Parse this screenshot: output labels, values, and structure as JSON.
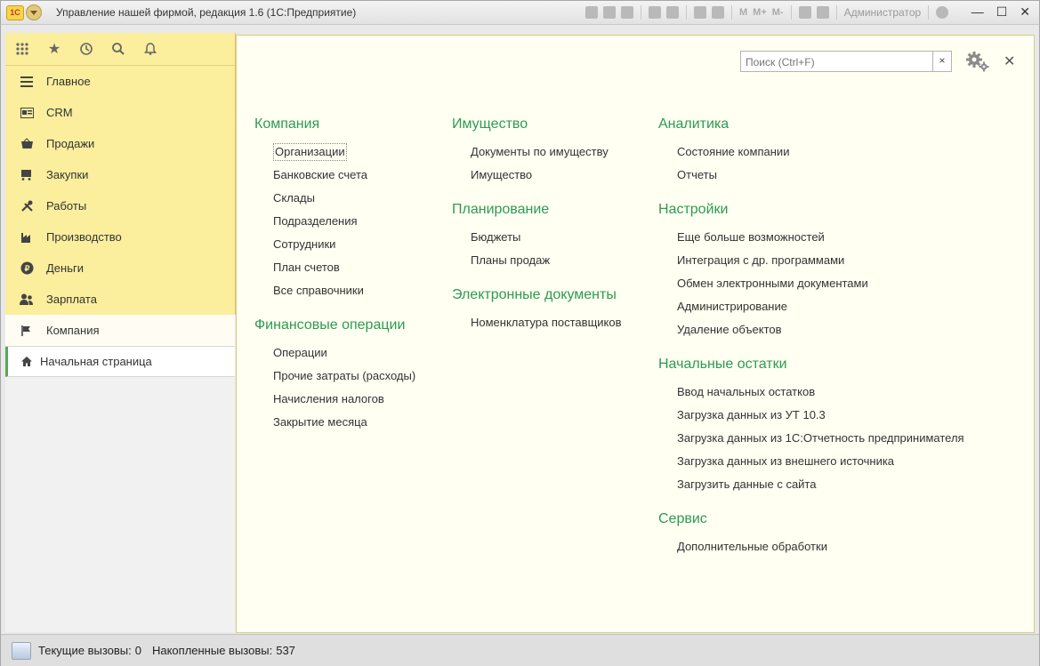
{
  "window": {
    "logo": "1С",
    "title": "Управление нашей фирмой, редакция 1.6  (1С:Предприятие)",
    "toolbar_letters": [
      "M",
      "M+",
      "M-"
    ],
    "user": "Администратор"
  },
  "sidebar": {
    "items": [
      {
        "label": "Главное",
        "icon": "menu-lines"
      },
      {
        "label": "CRM",
        "icon": "card"
      },
      {
        "label": "Продажи",
        "icon": "basket"
      },
      {
        "label": "Закупки",
        "icon": "cart"
      },
      {
        "label": "Работы",
        "icon": "tools"
      },
      {
        "label": "Производство",
        "icon": "factory"
      },
      {
        "label": "Деньги",
        "icon": "ruble-coin"
      },
      {
        "label": "Зарплата",
        "icon": "people"
      }
    ],
    "active_item": {
      "label": "Компания",
      "icon": "flag"
    },
    "home": {
      "label": "Начальная страница",
      "icon": "home"
    }
  },
  "search": {
    "placeholder": "Поиск (Ctrl+F)",
    "clear": "×"
  },
  "columns": [
    [
      {
        "title": "Компания",
        "links": [
          "Организации",
          "Банковские счета",
          "Склады",
          "Подразделения",
          "Сотрудники",
          "План счетов",
          "Все справочники"
        ]
      },
      {
        "title": "Финансовые операции",
        "links": [
          "Операции",
          "Прочие затраты (расходы)",
          "Начисления налогов",
          "Закрытие месяца"
        ]
      }
    ],
    [
      {
        "title": "Имущество",
        "links": [
          "Документы по имуществу",
          "Имущество"
        ]
      },
      {
        "title": "Планирование",
        "links": [
          "Бюджеты",
          "Планы продаж"
        ]
      },
      {
        "title": "Электронные документы",
        "links": [
          "Номенклатура поставщиков"
        ]
      }
    ],
    [
      {
        "title": "Аналитика",
        "links": [
          "Состояние компании",
          "Отчеты"
        ]
      },
      {
        "title": "Настройки",
        "links": [
          "Еще больше возможностей",
          "Интеграция с др. программами",
          "Обмен электронными документами",
          "Администрирование",
          "Удаление объектов"
        ]
      },
      {
        "title": "Начальные остатки",
        "links": [
          "Ввод начальных остатков",
          "Загрузка данных из УТ 10.3",
          "Загрузка данных из 1С:Отчетность предпринимателя",
          "Загрузка данных из внешнего источника",
          "Загрузить данные с сайта"
        ]
      },
      {
        "title": "Сервис",
        "links": [
          "Дополнительные обработки"
        ]
      }
    ]
  ],
  "status": {
    "current_label": "Текущие вызовы:",
    "current_value": "0",
    "total_label": "Накопленные вызовы:",
    "total_value": "537"
  },
  "colors": {
    "accent_green": "#2d9b52",
    "sidebar_bg": "#fbee9d",
    "main_bg": "#fffff2"
  }
}
